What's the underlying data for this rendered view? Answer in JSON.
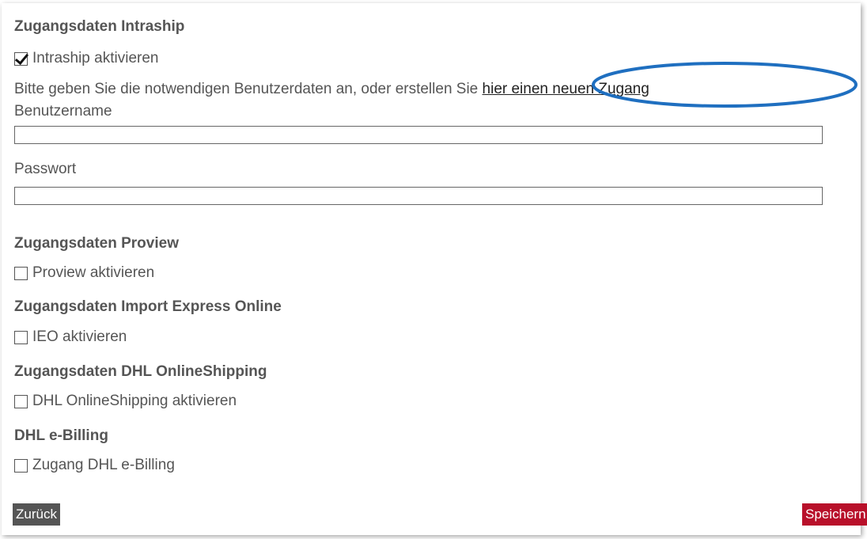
{
  "intraship": {
    "heading": "Zugangsdaten Intraship",
    "checkbox_label": "Intraship aktivieren",
    "checked": true,
    "info_text": "Bitte geben Sie die notwendigen Benutzerdaten an, oder erstellen Sie ",
    "link_text": "hier einen neuen Zugang",
    "username_label": "Benutzername",
    "username_value": "",
    "password_label": "Passwort",
    "password_value": ""
  },
  "proview": {
    "heading": "Zugangsdaten Proview",
    "checkbox_label": "Proview aktivieren",
    "checked": false
  },
  "ieo": {
    "heading": "Zugangsdaten Import Express Online",
    "checkbox_label": "IEO aktivieren",
    "checked": false
  },
  "online_shipping": {
    "heading": "Zugangsdaten DHL OnlineShipping",
    "checkbox_label": "DHL OnlineShipping aktivieren",
    "checked": false
  },
  "ebilling": {
    "heading": "DHL e-Billing",
    "checkbox_label": "Zugang DHL e-Billing",
    "checked": false
  },
  "buttons": {
    "back_label": "Zurück",
    "save_label": "Speichern"
  },
  "colors": {
    "save_button": "#b8102a",
    "back_button": "#555555",
    "annotation_oval": "#1f6fc0"
  },
  "icons": {
    "checkmark": "checkmark-icon"
  }
}
